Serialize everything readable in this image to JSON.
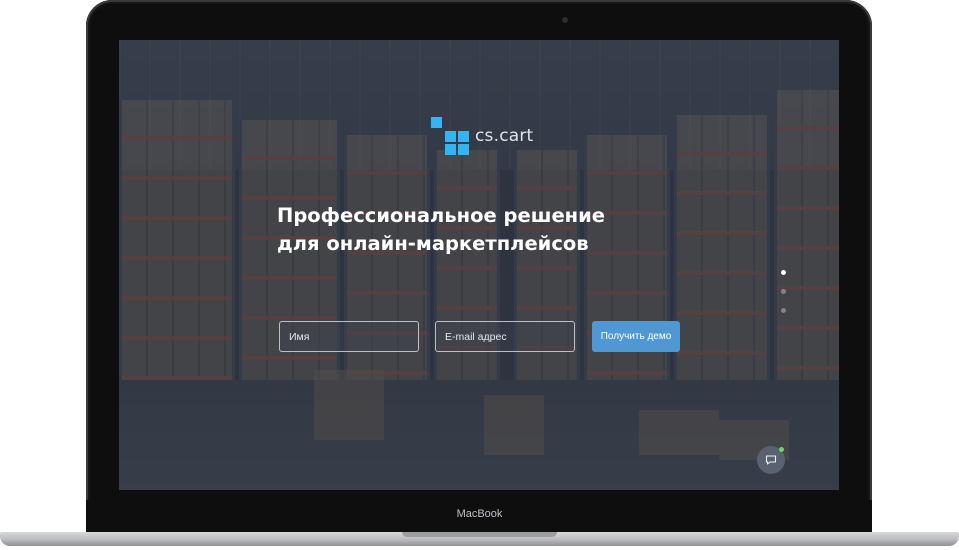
{
  "device": {
    "model_label": "MacBook"
  },
  "brand": {
    "logo_text": "cs.cart",
    "accent_color": "#35b4f2"
  },
  "hero": {
    "headline_line1": "Профессиональное решение",
    "headline_line2": "для онлайн-маркетплейсов"
  },
  "form": {
    "name_placeholder": "Имя",
    "email_placeholder": "E-mail адрес",
    "submit_label": "Получить демо",
    "submit_color": "#4f98d3"
  },
  "slider": {
    "dot_count": 3,
    "active_index": 0
  },
  "chat": {
    "icon": "chat-bubble-icon",
    "status_color": "#6bd66b"
  }
}
